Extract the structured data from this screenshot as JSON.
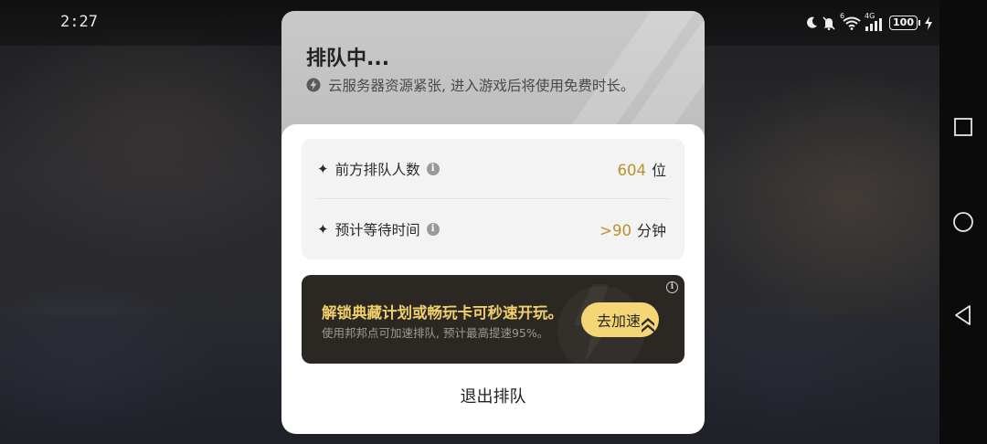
{
  "status_bar": {
    "time": "2:27",
    "network_label": "4G",
    "wifi_label": "6",
    "battery": "100",
    "icons": [
      "moon-icon",
      "bell-off-icon",
      "wifi-icon",
      "signal-icon",
      "battery-icon",
      "charging-icon"
    ]
  },
  "queue_header": {
    "title": "排队中...",
    "subtitle": "云服务器资源紧张, 进入游戏后将使用免费时长。"
  },
  "stats": [
    {
      "label": "前方排队人数",
      "value": "604",
      "unit": "位"
    },
    {
      "label": "预计等待时间",
      "value": ">90",
      "unit": "分钟"
    }
  ],
  "promo": {
    "title": "解锁典藏计划或畅玩卡可秒速开玩。",
    "description": "使用邦邦点可加速排队, 预计最高提速95%。",
    "button_label": "去加速"
  },
  "exit_label": "退出排队",
  "colors": {
    "accent_gold": "#b8922f",
    "promo_bg": "#2b2823",
    "promo_title": "#f0cf6a",
    "button_bg": "#f5d676"
  },
  "nav_buttons": [
    "recents-square-icon",
    "home-circle-icon",
    "back-triangle-icon"
  ]
}
